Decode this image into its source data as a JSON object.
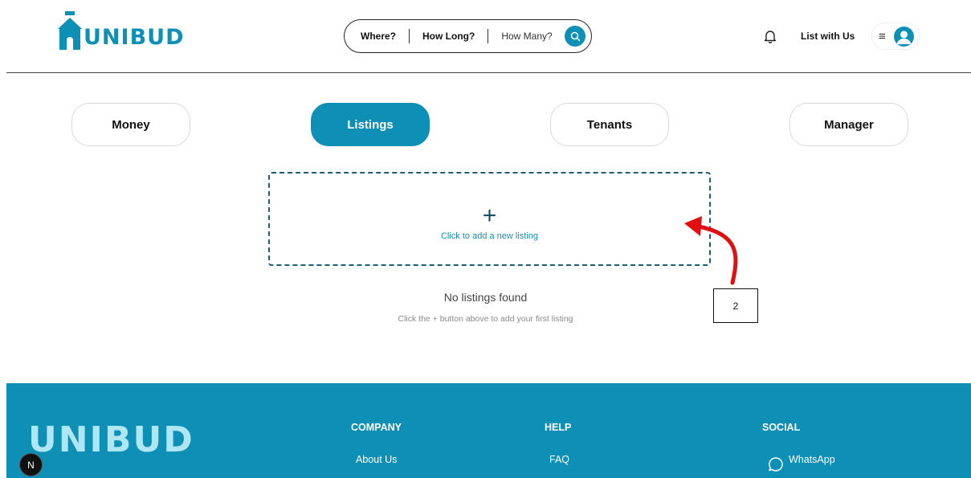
{
  "brand": {
    "name": "UNIBUD",
    "footer_name": "UNIBUD",
    "accent": "#0e8fb5"
  },
  "search": {
    "where_label": "Where?",
    "how_long_label": "How Long?",
    "how_many_label": "How Many?",
    "icon": "search-icon"
  },
  "header": {
    "list_with_us": "List with Us",
    "bell_icon": "bell-icon",
    "menu_icon": "hamburger-icon",
    "avatar_icon": "user-avatar-icon"
  },
  "tabs": [
    {
      "label": "Money",
      "active": false
    },
    {
      "label": "Listings",
      "active": true
    },
    {
      "label": "Tenants",
      "active": false
    },
    {
      "label": "Manager",
      "active": false
    }
  ],
  "listings": {
    "add_symbol": "+",
    "add_label": "Click to add a new listing",
    "empty_title": "No listings found",
    "empty_subtitle": "Click the + button above to add your first listing"
  },
  "annotation": {
    "label": "2",
    "color": "#e01010"
  },
  "footer": {
    "columns": [
      {
        "heading": "COMPANY",
        "links": [
          "About Us"
        ]
      },
      {
        "heading": "HELP",
        "links": [
          "FAQ"
        ]
      },
      {
        "heading": "SOCIAL",
        "links": [
          "WhatsApp"
        ]
      }
    ],
    "whatsapp_icon": "whatsapp-icon"
  },
  "dev_badge": {
    "label": "N"
  }
}
